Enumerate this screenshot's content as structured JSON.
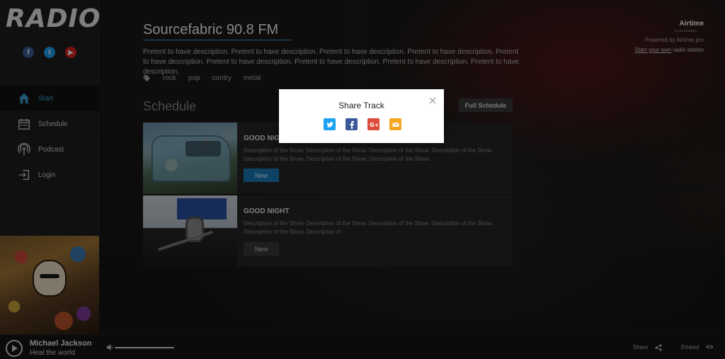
{
  "app": {
    "logo": "RADIO"
  },
  "sidebar": {
    "socials": [
      {
        "name": "facebook-icon",
        "glyph": "f"
      },
      {
        "name": "twitter-icon",
        "glyph": "t"
      },
      {
        "name": "youtube-icon",
        "glyph": "▶"
      }
    ],
    "items": [
      {
        "label": "Start",
        "icon": "home-icon",
        "active": true
      },
      {
        "label": "Schedule",
        "icon": "calendar-icon",
        "active": false
      },
      {
        "label": "Podcast",
        "icon": "podcast-icon",
        "active": false
      },
      {
        "label": "Login",
        "icon": "login-icon",
        "active": false
      }
    ],
    "album_art": "michael-jackson-dangerous-cover"
  },
  "main": {
    "station_title": "Sourcefabric 90.8 FM",
    "description": "Pretent to have description. Pretent to have description. Pretent to have description. Pretent to have description. Pretent to have description. Pretent to have description. Pretent to have description. Pretent to have description. Pretent to have description.",
    "tags": [
      "rock",
      "pop",
      "contry",
      "metal"
    ],
    "schedule_title": "Schedule",
    "full_schedule_label": "Full Schedule",
    "shows": [
      {
        "title": "GOOD NIGHT",
        "description": "Description of the Show. Description of the Show. Description of the Show. Description of the Show. Description of the Show. Description of the Show. Description of the Show.",
        "button": "Now"
      },
      {
        "title": "GOOD NIGHT",
        "description": "Description of the Show. Description of the Show. Description of the Show. Description of the Show. Description of the Show. Description of ...",
        "button": "Next"
      }
    ]
  },
  "branding": {
    "airtime": "Airtime",
    "airtime_sub": "SOURCEFABRIC",
    "powered_by": "Powered by Airtime.pro",
    "start_own_link": "Start your own",
    "start_own_rest": " radio station"
  },
  "player": {
    "artist": "Michael Jackson",
    "track": "Heal the world",
    "share_label": "Share",
    "embed_label": "Embed",
    "embed_glyph": "<>"
  },
  "modal": {
    "title": "Share Track",
    "buttons": [
      {
        "name": "twitter-share-button",
        "color": "#1da1f2"
      },
      {
        "name": "facebook-share-button",
        "color": "#3b5998"
      },
      {
        "name": "google-plus-share-button",
        "color": "#dd4b39"
      },
      {
        "name": "email-share-button",
        "color": "#f5a623"
      }
    ]
  },
  "colors": {
    "accent": "#3aa0d8",
    "now_button": "#1a7ab8"
  }
}
